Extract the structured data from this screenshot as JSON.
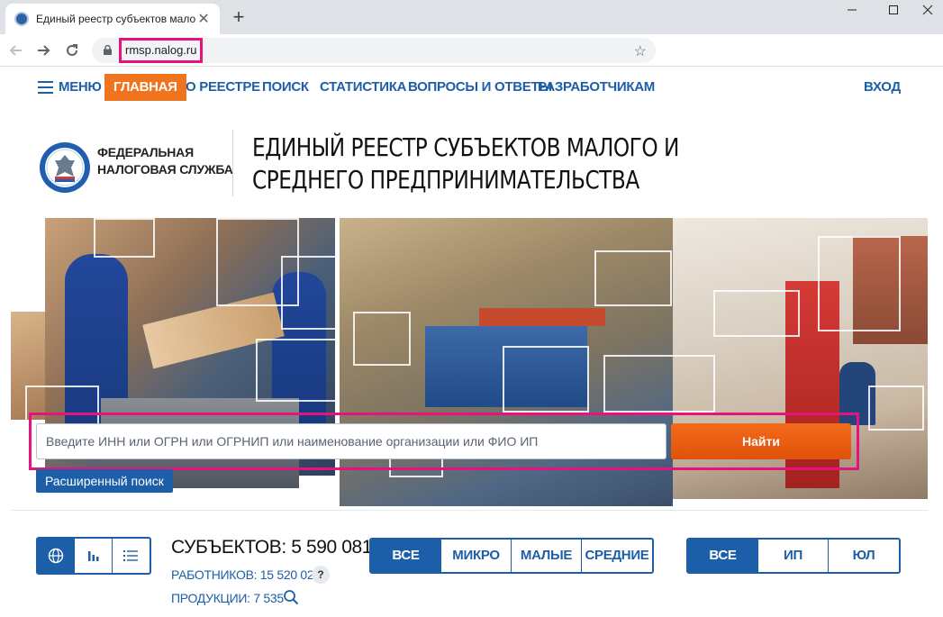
{
  "browser": {
    "tab_title": "Единый реестр субъектов мало",
    "url": "rmsp.nalog.ru"
  },
  "nav": {
    "menu_label": "МЕНЮ",
    "items": [
      "ГЛАВНАЯ",
      "О РЕЕСТРЕ",
      "ПОИСК",
      "СТАТИСТИКА",
      "ВОПРОСЫ И ОТВЕТЫ",
      "РАЗРАБОТЧИКАМ"
    ],
    "login": "ВХОД",
    "accent": "#f0731e",
    "link_color": "#1c5fa8"
  },
  "header": {
    "org_line1": "ФЕДЕРАЛЬНАЯ",
    "org_line2": "НАЛОГОВАЯ СЛУЖБА",
    "title": "ЕДИНЫЙ РЕЕСТР СУБЪЕКТОВ МАЛОГО И СРЕДНЕГО ПРЕДПРИНИМАТЕЛЬСТВА"
  },
  "search": {
    "placeholder": "Введите ИНН или ОГРН или ОГРНИП или наименование организации или ФИО ИП",
    "button": "Найти",
    "advanced": "Расширенный поиск"
  },
  "stats": {
    "subjects": "СУБЪЕКТОВ: 5 590 081",
    "workers": "РАБОТНИКОВ: 15 520 026",
    "products": "ПРОДУКЦИИ: 7 535",
    "help": "?",
    "size_filters": [
      "ВСЕ",
      "МИКРО",
      "МАЛЫЕ",
      "СРЕДНИЕ"
    ],
    "type_filters": [
      "ВСЕ",
      "ИП",
      "ЮЛ"
    ],
    "view_icons": [
      "globe-icon",
      "bar-chart-icon",
      "list-icon"
    ]
  }
}
